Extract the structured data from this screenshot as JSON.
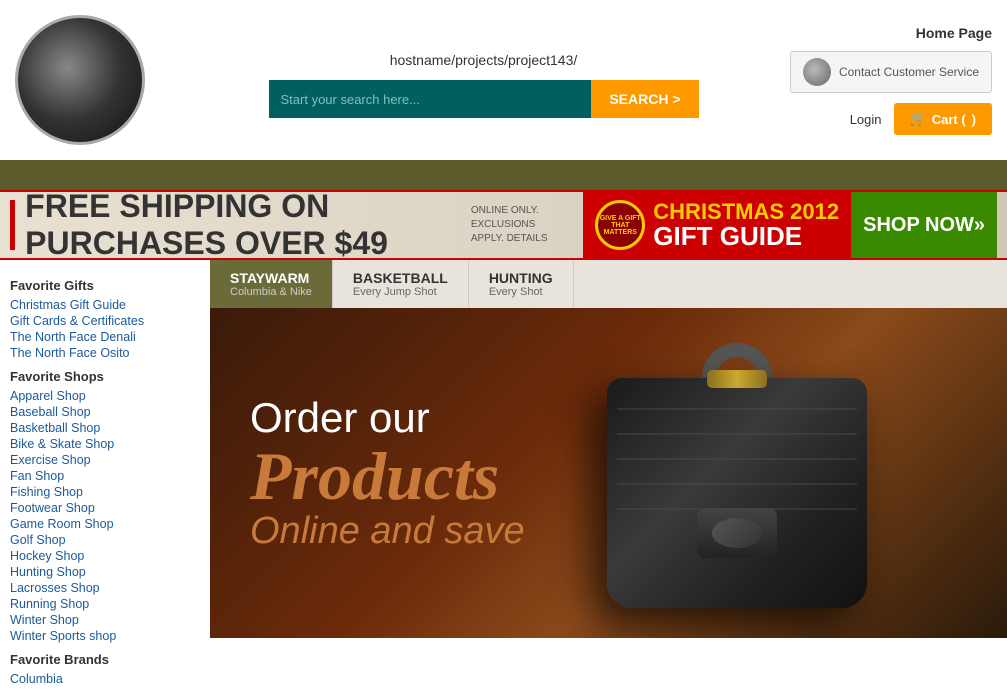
{
  "header": {
    "url": "hostname/projects/project143/",
    "home_page_label": "Home Page",
    "contact_button": "Contact Customer Service",
    "search_placeholder": "Start your search here...",
    "search_button": "SEARCH >",
    "login_label": "Login",
    "cart_label": "Cart ("
  },
  "nav": {},
  "banner": {
    "free_shipping": "FREE SHIPPING ON PURCHASES OVER $",
    "amount": "49",
    "online_only": "ONLINE ONLY.",
    "exclusions": "EXCLUSIONS APPLY. DETAILS",
    "give_gift": "GIVE A GIFT THAT MATTERS",
    "christmas": "CHRISTMAS 2012",
    "gift_guide": "GIFT GUIDE",
    "shop_now": "SHOP NOW»"
  },
  "sidebar": {
    "favorite_gifts_title": "Favorite Gifts",
    "favorite_gifts_links": [
      "Christmas Gift Guide",
      "Gift Cards & Certificates",
      "The North Face Denali",
      "The North Face Osito"
    ],
    "favorite_shops_title": "Favorite Shops",
    "favorite_shops_links": [
      "Apparel Shop",
      "Baseball Shop",
      "Basketball Shop",
      "Bike & Skate Shop",
      "Exercise Shop",
      "Fan Shop",
      "Fishing Shop",
      "Footwear Shop",
      "Game Room Shop",
      "Golf Shop",
      "Hockey Shop",
      "Hunting Shop",
      "Lacrosses Shop",
      "Running Shop",
      "Winter Shop",
      "Winter Sports shop"
    ],
    "favorite_brands_title": "Favorite Brands",
    "favorite_brands_links": [
      "Columbia"
    ]
  },
  "tabs": [
    {
      "id": "staywarm",
      "title": "STAYWARM",
      "sub": "Columbia & Nike",
      "active": true
    },
    {
      "id": "basketball",
      "title": "BASKETBALL",
      "sub": "Every Jump Shot",
      "active": false
    },
    {
      "id": "hunting",
      "title": "HUNTING",
      "sub": "Every Shot",
      "active": false
    }
  ],
  "hero": {
    "line1": "Order our",
    "line2": "Products",
    "line3": "Online and save"
  }
}
